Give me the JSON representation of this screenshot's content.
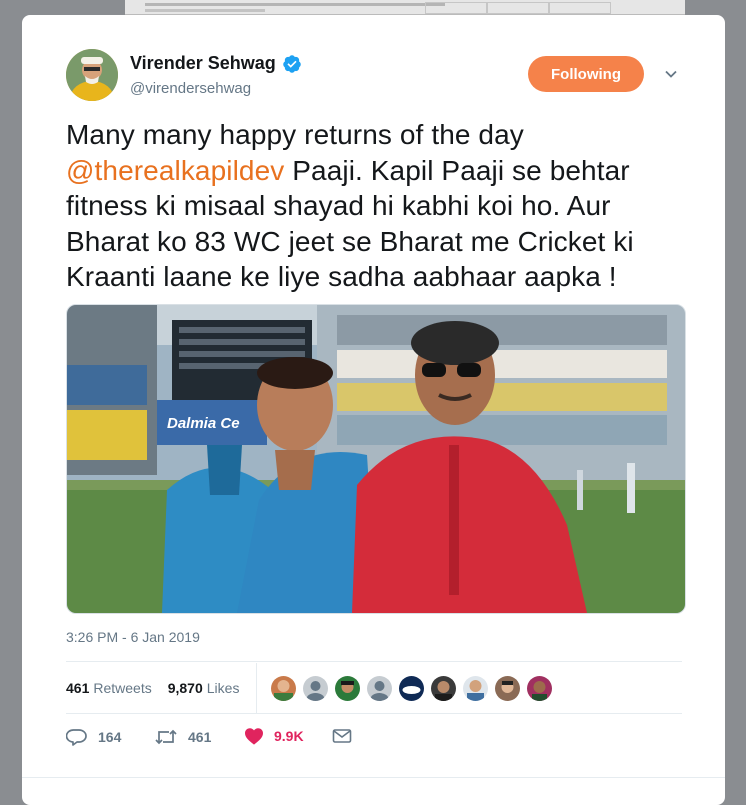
{
  "tweet": {
    "author_name": "Virender Sehwag",
    "author_handle": "@virendersehwag",
    "follow_label": "Following",
    "text_before": "Many many happy returns of the day ",
    "mention": "@therealkapildev",
    "text_after": " Paaji. Kapil Paaji se behtar fitness ki misaal shayad hi kabhi koi ho. Aur Bharat ko 83 WC jeet se Bharat me Cricket ki Kraanti laane ke liye sadha aabhaar aapka !",
    "timestamp": "3:26 PM - 6 Jan 2019",
    "retweets_count": "461",
    "retweets_label": "Retweets",
    "likes_count": "9,870",
    "likes_label": "Likes",
    "reply_count": "164",
    "retweet_action_count": "461",
    "like_action_count": "9.9K",
    "photo_banner_text": "Dalmia Ce"
  },
  "colors": {
    "accent": "#f5824a",
    "mention": "#e8711f",
    "like": "#e0245e",
    "verified": "#1da1f2",
    "secondary_text": "#657786"
  },
  "icons": [
    "verified-badge-icon",
    "chevron-down-icon",
    "reply-icon",
    "retweet-icon",
    "heart-icon",
    "mail-icon"
  ]
}
